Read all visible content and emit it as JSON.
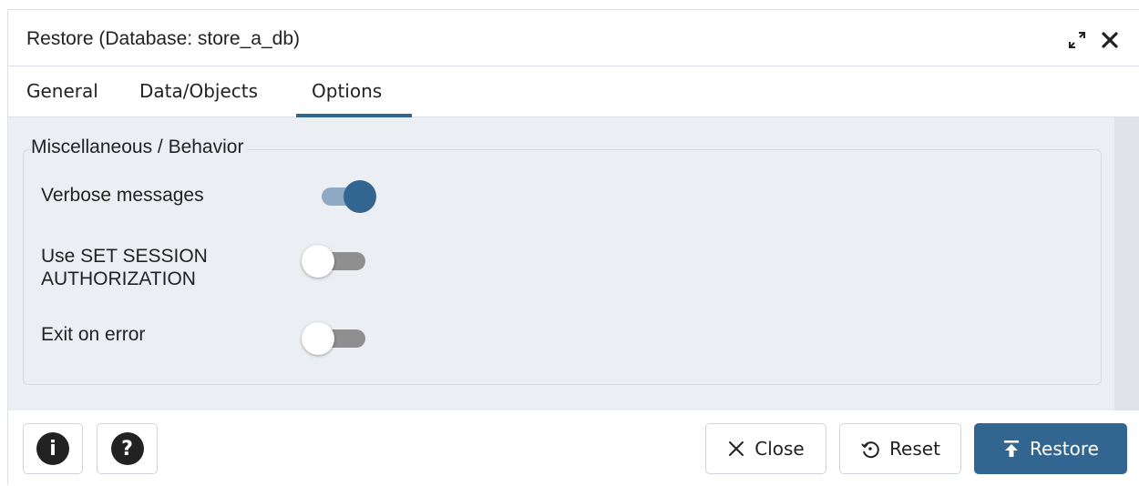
{
  "dialog": {
    "title": "Restore (Database: store_a_db)"
  },
  "tabs": [
    {
      "label": "General",
      "active": false
    },
    {
      "label": "Data/Objects",
      "active": false
    },
    {
      "label": "Options",
      "active": true
    }
  ],
  "section": {
    "legend": "Miscellaneous / Behavior",
    "options": [
      {
        "label": "Verbose messages",
        "enabled": true
      },
      {
        "label": "Use SET SESSION AUTHORIZATION",
        "enabled": false
      },
      {
        "label": "Exit on error",
        "enabled": false
      }
    ]
  },
  "footer": {
    "info_icon": "info-icon",
    "help_icon": "help-icon",
    "close_label": "Close",
    "reset_label": "Reset",
    "restore_label": "Restore"
  },
  "colors": {
    "accent": "#326690",
    "toggle_on_track": "#8ea9c4",
    "toggle_off_track": "#8f8f8f",
    "panel_bg": "#ebeef3"
  }
}
